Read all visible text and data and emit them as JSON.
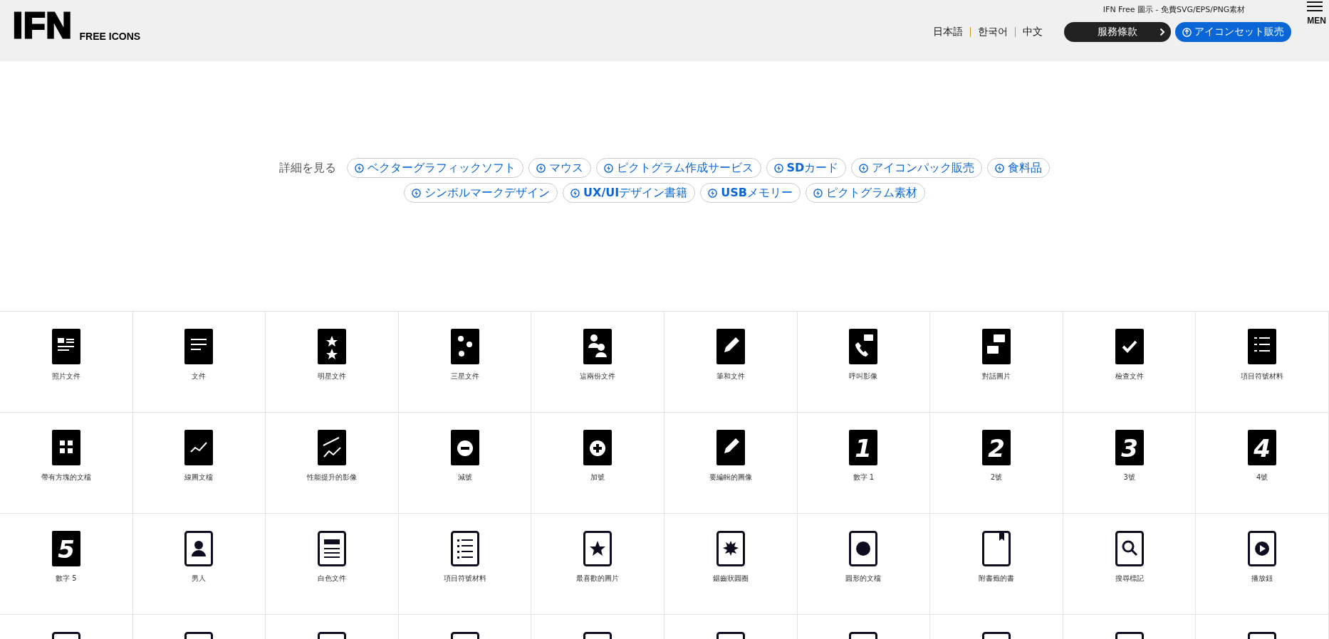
{
  "header": {
    "logo": "IFN",
    "logo_sub": "FREE ICONS",
    "tagline": "IFN Free 圖示 - 免費SVG/EPS/PNG素材",
    "languages": [
      "日本語",
      "한국어",
      "中文"
    ],
    "terms_button": "服務條款",
    "shop_button": "アイコンセット販売",
    "menu_label": "MEN"
  },
  "tags": {
    "label": "詳細を見る",
    "items": [
      "ベクターグラフィックソフト",
      "マウス",
      "ピクトグラム作成サービス",
      "**SD**カード",
      "アイコンパック販売",
      "食料品",
      "シンボルマークデザイン",
      "**UX/UI**デザイン書籍",
      "**USB**メモリー",
      "ピクトグラム素材"
    ]
  },
  "icons": [
    {
      "label": "照片文件",
      "kind": "filled"
    },
    {
      "label": "文件",
      "kind": "filled"
    },
    {
      "label": "明星文件",
      "kind": "filled"
    },
    {
      "label": "三星文件",
      "kind": "filled"
    },
    {
      "label": "這兩份文件",
      "kind": "filled"
    },
    {
      "label": "筆和文件",
      "kind": "filled"
    },
    {
      "label": "呼叫影像",
      "kind": "filled"
    },
    {
      "label": "對話圖片",
      "kind": "filled"
    },
    {
      "label": "檢查文件",
      "kind": "filled"
    },
    {
      "label": "項目符號材料",
      "kind": "filled"
    },
    {
      "label": "帶有方塊的文檔",
      "kind": "filled"
    },
    {
      "label": "線圖文檔",
      "kind": "filled"
    },
    {
      "label": "性能提升的影像",
      "kind": "filled"
    },
    {
      "label": "減號",
      "kind": "filled"
    },
    {
      "label": "加號",
      "kind": "filled"
    },
    {
      "label": "要編輯的圖像",
      "kind": "filled"
    },
    {
      "label": "數字 1",
      "kind": "filled",
      "digit": "1"
    },
    {
      "label": "2號",
      "kind": "filled",
      "digit": "2"
    },
    {
      "label": "3號",
      "kind": "filled",
      "digit": "3"
    },
    {
      "label": "4號",
      "kind": "filled",
      "digit": "4"
    },
    {
      "label": "數字 5",
      "kind": "filled",
      "digit": "5"
    },
    {
      "label": "男人",
      "kind": "outline"
    },
    {
      "label": "白色文件",
      "kind": "outline"
    },
    {
      "label": "項目符號材料",
      "kind": "outline"
    },
    {
      "label": "最喜歡的圖片",
      "kind": "outline"
    },
    {
      "label": "鋸齒狀圓圈",
      "kind": "outline"
    },
    {
      "label": "圓形的文檔",
      "kind": "outline"
    },
    {
      "label": "附書籤的書",
      "kind": "outline"
    },
    {
      "label": "搜尋標記",
      "kind": "outline"
    },
    {
      "label": "播放鈕",
      "kind": "outline"
    },
    {
      "kind": "outline"
    },
    {
      "kind": "outline"
    },
    {
      "kind": "outline"
    },
    {
      "kind": "outline"
    },
    {
      "kind": "outline"
    },
    {
      "kind": "outline"
    },
    {
      "kind": "outline"
    },
    {
      "kind": "outline"
    },
    {
      "kind": "outline"
    },
    {
      "kind": "outline"
    }
  ]
}
